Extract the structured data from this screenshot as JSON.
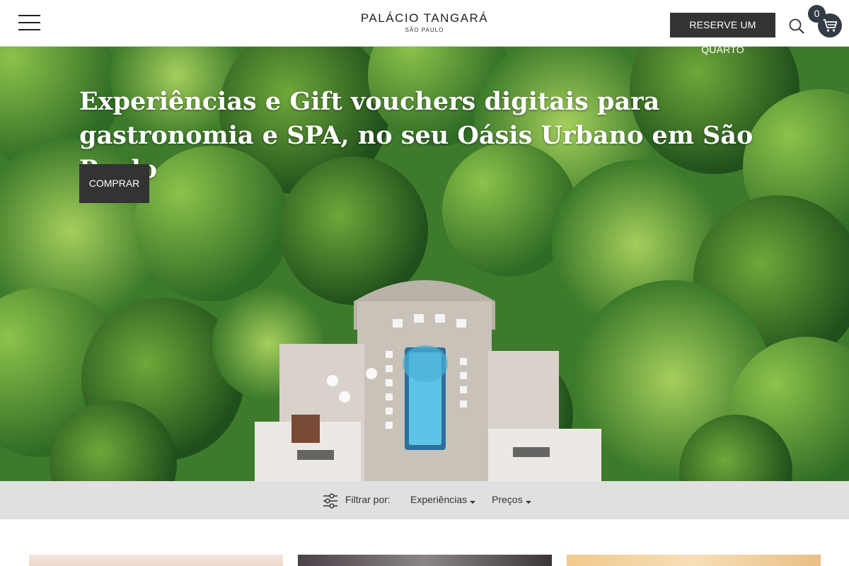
{
  "header": {
    "logo_title": "PALÁCIO TANGARÁ",
    "logo_subtitle": "SÃO PAULO",
    "reserve_label": "RESERVE UM QUARTO",
    "cart_count": "0",
    "icons": [
      "menu-icon",
      "search-icon",
      "cart-icon"
    ]
  },
  "hero": {
    "title": "Experiências e Gift vouchers digitais para gastronomia e SPA, no seu Oásis Urbano em São Paulo",
    "button_label": "COMPRAR"
  },
  "filters": {
    "label": "Filtrar por:",
    "experiences": "Experiências",
    "prices": "Preços"
  },
  "colors": {
    "button_dark": "#333333",
    "cart_bg": "#333b44",
    "filter_bar": "#e0e0e0"
  }
}
